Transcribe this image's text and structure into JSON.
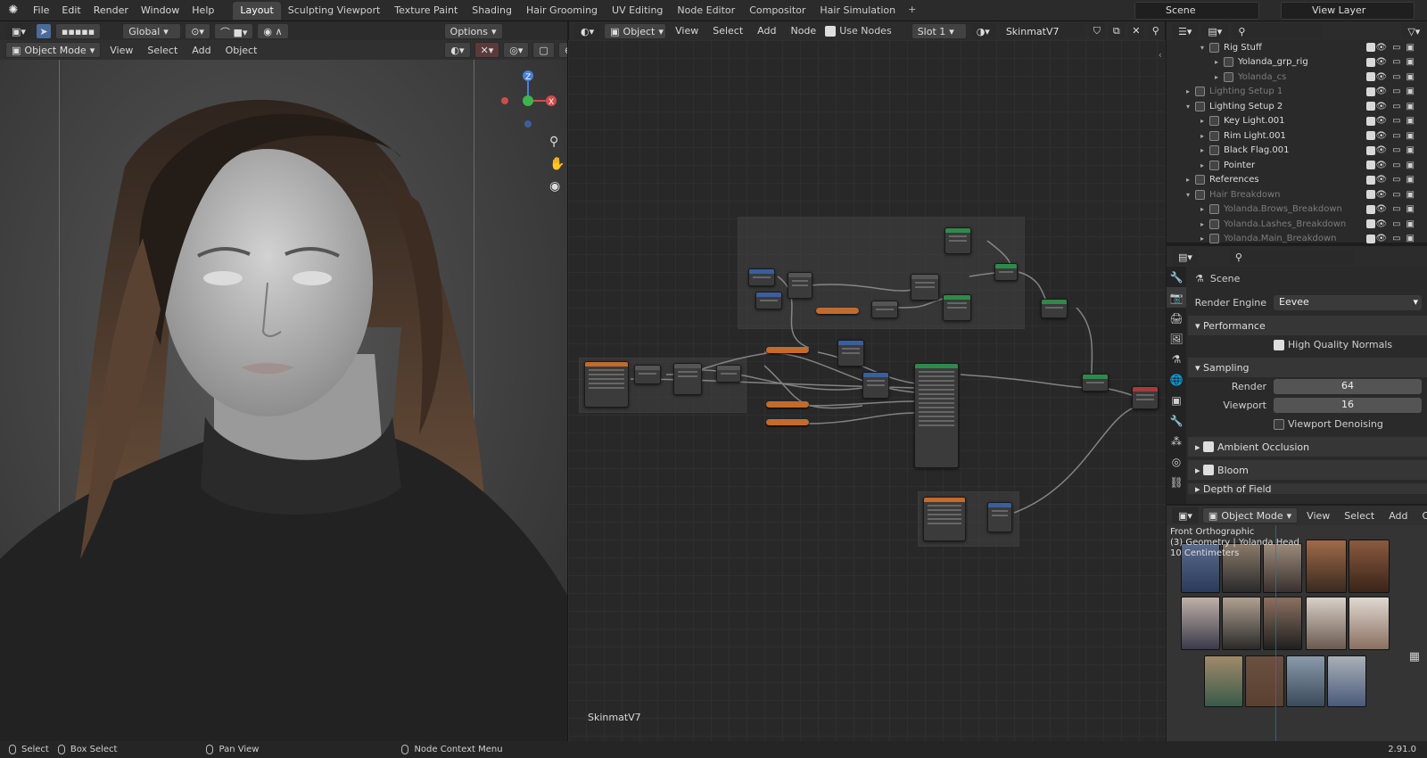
{
  "app": {
    "version": "2.91.0"
  },
  "menu": [
    "File",
    "Edit",
    "Render",
    "Window",
    "Help"
  ],
  "workspaces": [
    "Layout",
    "Sculpting Viewport",
    "Texture Paint",
    "Shading",
    "Hair Grooming",
    "UV Editing",
    "Node Editor",
    "Compositor",
    "Hair Simulation"
  ],
  "active_workspace": "Layout",
  "scene_name": "Scene",
  "view_layer": "View Layer",
  "viewport_header": {
    "transform_orientation": "Global",
    "options_label": "Options",
    "mode": "Object Mode",
    "menus": [
      "View",
      "Select",
      "Add",
      "Object"
    ]
  },
  "node_header": {
    "type": "Object",
    "menus": [
      "View",
      "Select",
      "Add",
      "Node"
    ],
    "use_nodes_label": "Use Nodes",
    "slot": "Slot 1",
    "material": "SkinmatV7"
  },
  "node_editor": {
    "material_label": "SkinmatV7"
  },
  "gizmo": {
    "z": "Z",
    "y": "Y",
    "x": "X"
  },
  "outliner": {
    "rows": [
      {
        "label": "Rig Stuff",
        "indent": 2,
        "expanded": true,
        "dim": false
      },
      {
        "label": "Yolanda_grp_rig",
        "indent": 3,
        "expanded": false,
        "dim": false
      },
      {
        "label": "Yolanda_cs",
        "indent": 3,
        "expanded": false,
        "dim": true
      },
      {
        "label": "Lighting Setup 1",
        "indent": 1,
        "expanded": false,
        "dim": true
      },
      {
        "label": "Lighting Setup 2",
        "indent": 1,
        "expanded": true,
        "dim": false
      },
      {
        "label": "Key Light.001",
        "indent": 2,
        "expanded": false,
        "dim": false
      },
      {
        "label": "Rim Light.001",
        "indent": 2,
        "expanded": false,
        "dim": false
      },
      {
        "label": "Black Flag.001",
        "indent": 2,
        "expanded": false,
        "dim": false
      },
      {
        "label": "Pointer",
        "indent": 2,
        "expanded": false,
        "dim": false
      },
      {
        "label": "References",
        "indent": 1,
        "expanded": false,
        "dim": false
      },
      {
        "label": "Hair Breakdown",
        "indent": 1,
        "expanded": true,
        "dim": true
      },
      {
        "label": "Yolanda.Brows_Breakdown",
        "indent": 2,
        "expanded": false,
        "dim": true
      },
      {
        "label": "Yolanda.Lashes_Breakdown",
        "indent": 2,
        "expanded": false,
        "dim": true
      },
      {
        "label": "Yolanda.Main_Breakdown",
        "indent": 2,
        "expanded": false,
        "dim": true
      }
    ]
  },
  "properties": {
    "context": "Scene",
    "render_engine_label": "Render Engine",
    "render_engine": "Eevee",
    "performance": "Performance",
    "high_quality_normals": "High Quality Normals",
    "sampling": "Sampling",
    "render_label": "Render",
    "render_value": "64",
    "viewport_label": "Viewport",
    "viewport_value": "16",
    "viewport_denoising": "Viewport Denoising",
    "ambient_occlusion": "Ambient Occlusion",
    "bloom": "Bloom",
    "depth_of_field": "Depth of Field"
  },
  "image_editor": {
    "mode": "Object Mode",
    "menus": [
      "View",
      "Select",
      "Add",
      "Object"
    ],
    "view_name": "Front Orthographic",
    "info_line": "(3) Geometry | Yolanda Head",
    "scale": "10 Centimeters"
  },
  "status": {
    "select": "Select",
    "box_select": "Box Select",
    "pan_view": "Pan View",
    "context_menu": "Node Context Menu"
  },
  "colors": {
    "accent": "#4a7fd6",
    "node_orange": "#c46a2a",
    "node_green": "#2f8a4a",
    "node_blue": "#3a5f9a"
  }
}
